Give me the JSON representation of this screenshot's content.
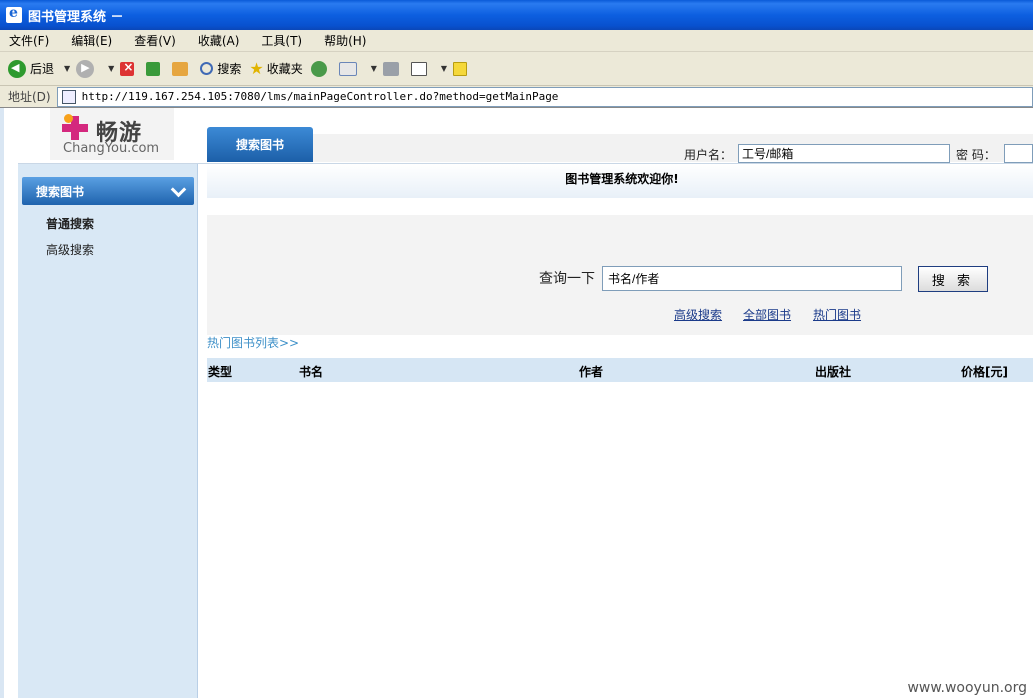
{
  "window": {
    "title": "图书管理系统 －"
  },
  "menu": {
    "items": [
      "文件(F)",
      "编辑(E)",
      "查看(V)",
      "收藏(A)",
      "工具(T)",
      "帮助(H)"
    ]
  },
  "toolbar": {
    "back_label": "后退",
    "search_label": "搜索",
    "favorites_label": "收藏夹"
  },
  "address": {
    "label": "地址(D)",
    "url": "http://119.167.254.105:7080/lms/mainPageController.do?method=getMainPage"
  },
  "header": {
    "logo_cn": "畅游",
    "logo_en": "ChangYou.com",
    "tab_label": "搜索图书",
    "username_label": "用户名：",
    "username_value": "工号/邮箱",
    "password_label": "密 码："
  },
  "sidebar": {
    "title": "搜索图书",
    "items": [
      "普通搜索",
      "高级搜索"
    ]
  },
  "main": {
    "welcome": "图书管理系统欢迎你!",
    "search": {
      "label": "查询一下",
      "value": "书名/作者",
      "button": "搜 索",
      "links": [
        "高级搜索",
        "全部图书",
        "热门图书"
      ]
    },
    "hot_title": "热门图书列表>>",
    "table_columns": [
      "类型",
      "书名",
      "作者",
      "出版社",
      "价格[元]"
    ]
  },
  "watermark": "www.wooyun.org"
}
